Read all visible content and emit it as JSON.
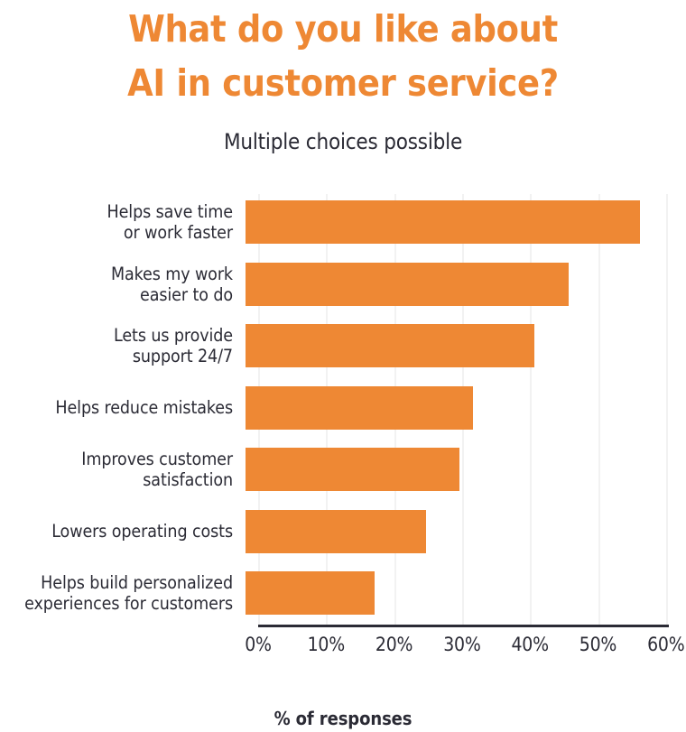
{
  "title": {
    "line1": "What do you like about",
    "line2": "AI in customer service?"
  },
  "subtitle": "Multiple choices possible",
  "colors": {
    "bar": "#ee8834",
    "title": "#ee8834",
    "text": "#2b2b35",
    "gridline": "#f2f2f2",
    "axis": "#2b2b35",
    "background": "#ffffff"
  },
  "chart_data": {
    "type": "bar",
    "orientation": "horizontal",
    "title": "What do you like about AI in customer service?",
    "subtitle": "Multiple choices possible",
    "xlabel": "% of responses",
    "ylabel": "",
    "xlim": [
      0,
      62
    ],
    "xticks": [
      0,
      10,
      20,
      30,
      40,
      50,
      60
    ],
    "xtick_labels": [
      "0%",
      "10%",
      "20%",
      "30%",
      "40%",
      "50%",
      "60%"
    ],
    "grid": "vertical",
    "legend": "none",
    "categories": [
      "Helps save time\nor work faster",
      "Makes my work\neasier to do",
      "Lets us provide\nsupport 24/7",
      "Helps reduce mistakes",
      "Improves customer\nsatisfaction",
      "Lowers operating costs",
      "Helps build personalized\nexperiences for customers"
    ],
    "values": [
      58,
      47.5,
      42.5,
      33.5,
      31.5,
      26.5,
      19
    ],
    "series": [
      {
        "name": "% of responses",
        "values": [
          58,
          47.5,
          42.5,
          33.5,
          31.5,
          26.5,
          19
        ]
      }
    ]
  }
}
